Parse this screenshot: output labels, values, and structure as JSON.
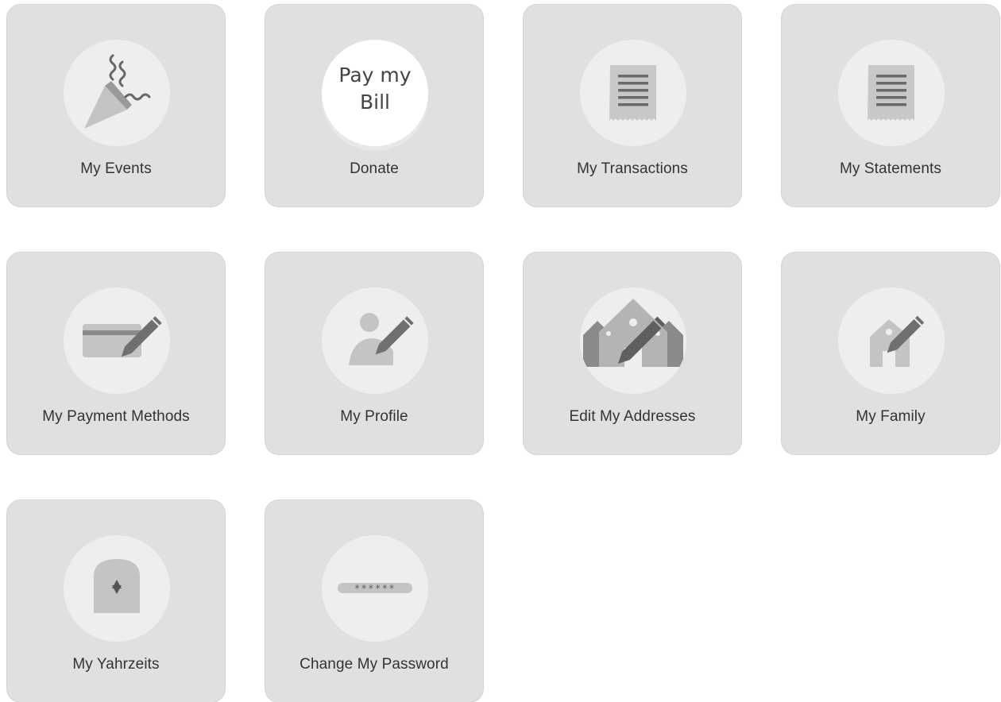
{
  "tiles": [
    {
      "label": "My Events",
      "icon": "party-popper-icon"
    },
    {
      "label": "Donate",
      "icon": "pay-my-bill-badge",
      "badge_lines": [
        "Pay my",
        "Bill"
      ]
    },
    {
      "label": "My Transactions",
      "icon": "receipt-icon"
    },
    {
      "label": "My Statements",
      "icon": "receipt-icon"
    },
    {
      "label": "My Payment Methods",
      "icon": "credit-card-edit-icon"
    },
    {
      "label": "My Profile",
      "icon": "user-edit-icon"
    },
    {
      "label": "Edit My Addresses",
      "icon": "houses-edit-icon"
    },
    {
      "label": "My Family",
      "icon": "house-edit-icon"
    },
    {
      "label": "My Yahrzeits",
      "icon": "headstone-star-icon"
    },
    {
      "label": "Change My Password",
      "icon": "password-field-icon",
      "password_mask": "******"
    }
  ],
  "colors": {
    "tile_background": "#e0e0e0",
    "icon_circle": "#eeeeee",
    "icon_light": "#c2c2c2",
    "icon_dark": "#6f6f6f",
    "label_text": "#333333"
  }
}
